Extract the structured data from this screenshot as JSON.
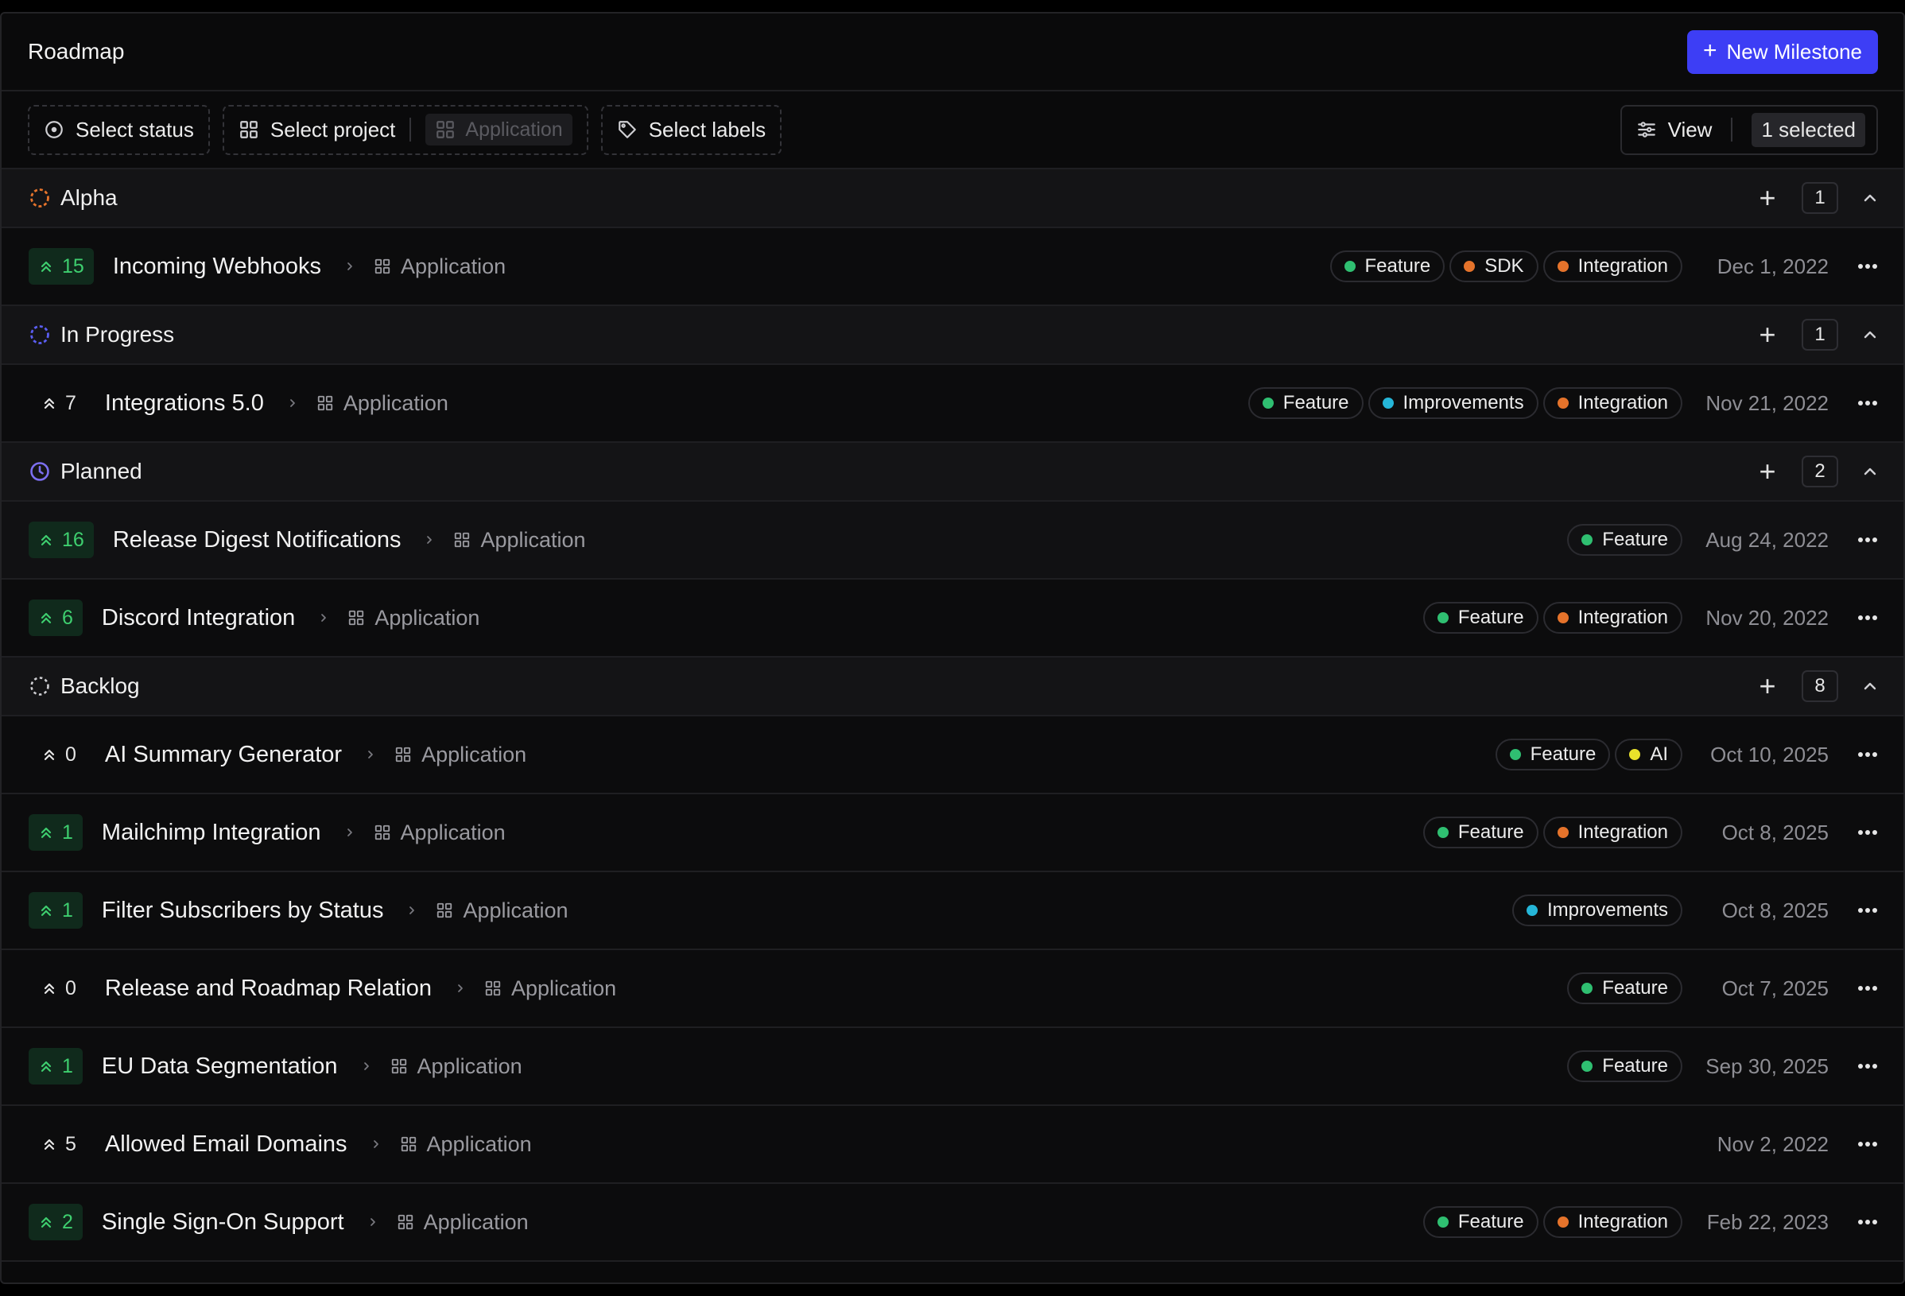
{
  "header": {
    "title": "Roadmap",
    "new_button": "New Milestone"
  },
  "filters": {
    "status": "Select status",
    "project": "Select project",
    "project_value": "Application",
    "labels": "Select labels",
    "view": "View",
    "selected": "1 selected"
  },
  "colors": {
    "accent": "#3d3ef5",
    "Feature": "#2fbf71",
    "SDK": "#e5732b",
    "Integration": "#e5732b",
    "Improvements": "#25b6d8",
    "AI": "#e9e22b"
  },
  "groups": [
    {
      "name": "Alpha",
      "icon": "alpha-status-icon",
      "count": "1",
      "items": [
        {
          "votes": "15",
          "active": true,
          "title": "Incoming Webhooks",
          "project": "Application",
          "labels": [
            "Feature",
            "SDK",
            "Integration"
          ],
          "date": "Dec 1, 2022"
        }
      ]
    },
    {
      "name": "In Progress",
      "icon": "in-progress-status-icon",
      "count": "1",
      "items": [
        {
          "votes": "7",
          "active": false,
          "title": "Integrations 5.0",
          "project": "Application",
          "labels": [
            "Feature",
            "Improvements",
            "Integration"
          ],
          "date": "Nov 21, 2022"
        }
      ]
    },
    {
      "name": "Planned",
      "icon": "clock-icon",
      "count": "2",
      "items": [
        {
          "votes": "16",
          "active": true,
          "title": "Release Digest Notifications",
          "project": "Application",
          "labels": [
            "Feature"
          ],
          "date": "Aug 24, 2022",
          "highlight": true
        },
        {
          "votes": "6",
          "active": true,
          "title": "Discord Integration",
          "project": "Application",
          "labels": [
            "Feature",
            "Integration"
          ],
          "date": "Nov 20, 2022"
        }
      ]
    },
    {
      "name": "Backlog",
      "icon": "backlog-status-icon",
      "count": "8",
      "items": [
        {
          "votes": "0",
          "active": false,
          "title": "AI Summary Generator",
          "project": "Application",
          "labels": [
            "Feature",
            "AI"
          ],
          "date": "Oct 10, 2025"
        },
        {
          "votes": "1",
          "active": true,
          "title": "Mailchimp Integration",
          "project": "Application",
          "labels": [
            "Feature",
            "Integration"
          ],
          "date": "Oct 8, 2025"
        },
        {
          "votes": "1",
          "active": true,
          "title": "Filter Subscribers by Status",
          "project": "Application",
          "labels": [
            "Improvements"
          ],
          "date": "Oct 8, 2025"
        },
        {
          "votes": "0",
          "active": false,
          "title": "Release and Roadmap Relation",
          "project": "Application",
          "labels": [
            "Feature"
          ],
          "date": "Oct 7, 2025"
        },
        {
          "votes": "1",
          "active": true,
          "title": "EU Data Segmentation",
          "project": "Application",
          "labels": [
            "Feature"
          ],
          "date": "Sep 30, 2025"
        },
        {
          "votes": "5",
          "active": false,
          "title": "Allowed Email Domains",
          "project": "Application",
          "labels": [],
          "date": "Nov 2, 2022"
        },
        {
          "votes": "2",
          "active": true,
          "title": "Single Sign-On Support",
          "project": "Application",
          "labels": [
            "Feature",
            "Integration"
          ],
          "date": "Feb 22, 2023"
        }
      ]
    }
  ]
}
